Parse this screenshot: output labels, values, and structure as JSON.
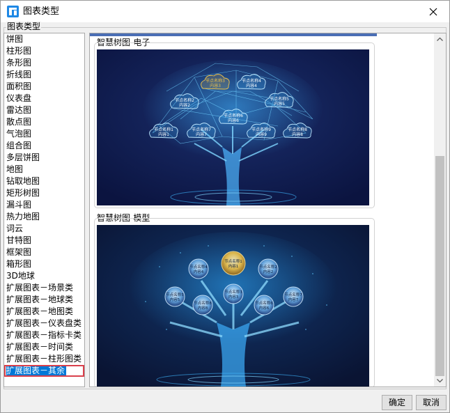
{
  "window": {
    "title": "图表类型"
  },
  "group": {
    "label": "图表类型"
  },
  "chart_types": [
    "饼图",
    "柱形图",
    "条形图",
    "折线图",
    "面积图",
    "仪表盘",
    "雷达图",
    "散点图",
    "气泡图",
    "组合图",
    "多层饼图",
    "地图",
    "钻取地图",
    "矩形树图",
    "漏斗图",
    "热力地图",
    "词云",
    "甘特图",
    "框架图",
    "箱形图",
    "3D地球",
    "扩展图表－场景类",
    "扩展图表－地球类",
    "扩展图表－地图类",
    "扩展图表－仪表盘类",
    "扩展图表－指标卡类",
    "扩展图表－时间类",
    "扩展图表－柱形图类",
    "扩展图表－其余"
  ],
  "selected_index": 28,
  "previews": [
    {
      "title": "智慧树图-电子",
      "nodes": [
        {
          "name": "节点名称3",
          "content": "内容3"
        },
        {
          "name": "节点名称4",
          "content": "内容4"
        },
        {
          "name": "节点名称2",
          "content": "内容2"
        },
        {
          "name": "节点名称5",
          "content": "内容5"
        },
        {
          "name": "节点名称6",
          "content": "内容6"
        },
        {
          "name": "节点名称1",
          "content": "内容1"
        },
        {
          "name": "节点名称7",
          "content": "内容7"
        },
        {
          "name": "节点名称9",
          "content": "内容9"
        },
        {
          "name": "节点名称8",
          "content": "内容8"
        }
      ]
    },
    {
      "title": "智慧树图-模型",
      "nodes": [
        {
          "name": "节点名称1",
          "content": "内容1"
        },
        {
          "name": "节点名称4",
          "content": "内容4"
        },
        {
          "name": "节点名称2",
          "content": "内容2"
        },
        {
          "name": "节点名称5",
          "content": "内容5"
        },
        {
          "name": "节点名称3",
          "content": "内容3"
        },
        {
          "name": "节点名称7",
          "content": "内容7"
        },
        {
          "name": "节点名称8",
          "content": "内容8"
        },
        {
          "name": "节点名称6",
          "content": "内容6"
        }
      ]
    }
  ],
  "buttons": {
    "ok": "确定",
    "cancel": "取消"
  },
  "colors": {
    "selection": "#0078d7",
    "selection_border": "#d9404b",
    "accent_strip": "#4a6eb5",
    "preview_bg": "#0b1440",
    "glow": "#3fb8ff",
    "highlight": "#f2c44a"
  }
}
